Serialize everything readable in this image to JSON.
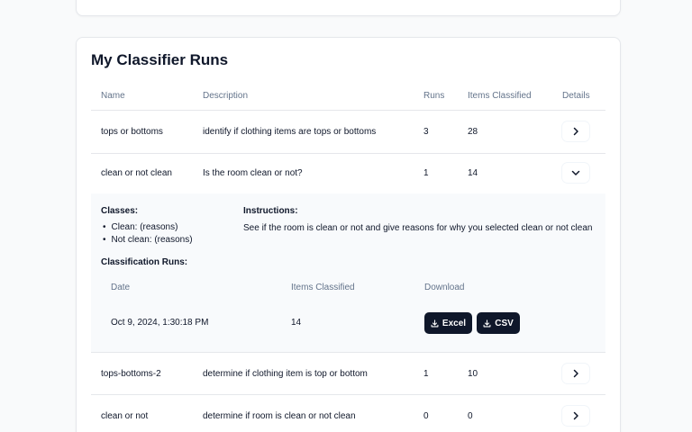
{
  "card": {
    "title": "My Classifier Runs"
  },
  "table": {
    "headers": {
      "name": "Name",
      "description": "Description",
      "runs": "Runs",
      "items": "Items Classified",
      "details": "Details"
    },
    "rows": [
      {
        "name": "tops or bottoms",
        "description": "identify if clothing items are tops or bottoms",
        "runs": "3",
        "items": "28",
        "expanded": false
      },
      {
        "name": "clean or not clean",
        "description": "Is the room clean or not?",
        "runs": "1",
        "items": "14",
        "expanded": true
      },
      {
        "name": "tops-bottoms-2",
        "description": "determine if clothing item is top or bottom",
        "runs": "1",
        "items": "10",
        "expanded": false
      },
      {
        "name": "clean or not",
        "description": "determine if room is clean or not clean",
        "runs": "0",
        "items": "0",
        "expanded": false
      }
    ]
  },
  "expanded": {
    "classes_label": "Classes:",
    "classes": [
      "Clean: (reasons)",
      "Not clean: (reasons)"
    ],
    "instructions_label": "Instructions:",
    "instructions": "See if the room is clean or not and give reasons for why you selected clean or not clean",
    "runs_label": "Classification Runs:",
    "runs_headers": {
      "date": "Date",
      "items": "Items Classified",
      "download": "Download"
    },
    "runs": [
      {
        "date": "Oct 9, 2024, 1:30:18 PM",
        "items": "14"
      }
    ],
    "download": {
      "excel": "Excel",
      "csv": "CSV"
    }
  },
  "icons": {
    "chevron_right": "chevron-right-icon",
    "chevron_down": "chevron-down-icon",
    "download": "download-icon"
  },
  "colors": {
    "primary_button": "#0f172a",
    "expanded_bg": "#f8fafc",
    "border": "#e5e7eb"
  }
}
